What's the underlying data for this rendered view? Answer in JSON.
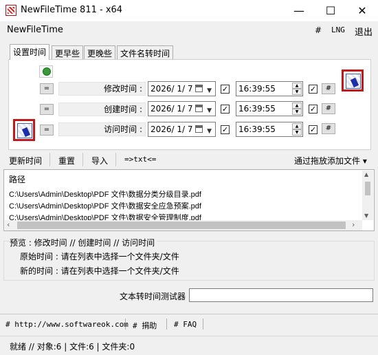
{
  "window": {
    "title": "NewFileTime 811 - x64",
    "minimize": "—",
    "maximize": "☐",
    "close": "✕"
  },
  "menu": {
    "app_name": "NewFileTime",
    "hash": "#",
    "lng": "LNG",
    "exit": "退出"
  },
  "tabs": [
    "设置时间",
    "更早些",
    "更晚些",
    "文件名转时间"
  ],
  "rows": [
    {
      "eq": "=",
      "label": "修改时间 :",
      "date": "2026/ 1/ 7",
      "time": "16:39:55",
      "hash": "#"
    },
    {
      "eq": "=",
      "label": "创建时间 :",
      "date": "2026/ 1/ 7",
      "time": "16:39:55",
      "hash": "#"
    },
    {
      "eq": "=",
      "label": "访问时间 :",
      "date": "2026/ 1/ 7",
      "time": "16:39:55",
      "hash": "#"
    }
  ],
  "check_mark": "✓",
  "toolbar": {
    "update": "更新时间",
    "reset": "重置",
    "import": "导入",
    "txt": "=>txt<=",
    "add_by_drag": "通过拖放添加文件 ▾"
  },
  "filelist": {
    "header": "路径",
    "items": [
      "C:\\Users\\Admin\\Desktop\\PDF 文件\\数据分类分级目录.pdf",
      "C:\\Users\\Admin\\Desktop\\PDF 文件\\数据安全应急预案.pdf",
      "C:\\Users\\Admin\\Desktop\\PDF 文件\\数据安全管理制度.pdf"
    ]
  },
  "preview": {
    "title": "预览 :  修改时间  //  创建时间  //  访问时间",
    "original_label": "原始时间 : 请在列表中选择一个文件夹/文件",
    "new_label": "新的时间 : 请在列表中选择一个文件夹/文件"
  },
  "tester": {
    "label": "文本转时间测试器",
    "value": ""
  },
  "footer": {
    "website": "# http://www.softwareok.com",
    "donate": "# 捐助",
    "faq": "# FAQ"
  },
  "status": "就绪 // 对象:6  | 文件:6  | 文件夹:0"
}
